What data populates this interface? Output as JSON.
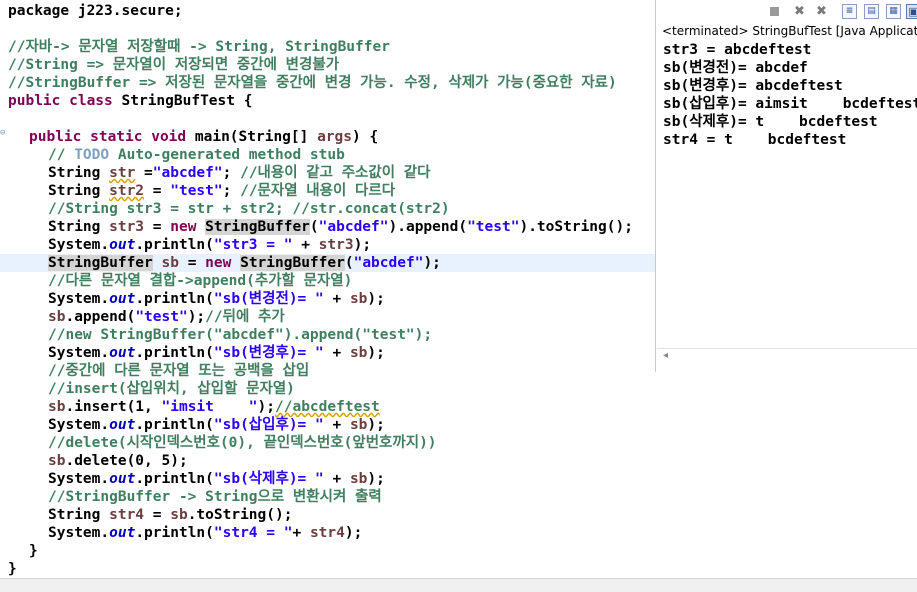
{
  "editor": {
    "current_line_index": 14,
    "lines": [
      {
        "indent": 0,
        "tokens": [
          {
            "t": "package j223.secure;",
            "c": "pl"
          }
        ]
      },
      {
        "indent": 0,
        "tokens": []
      },
      {
        "indent": 0,
        "tokens": [
          {
            "t": "//자바-> 문자열 저장할때 -> String, StringBuffer",
            "c": "cm"
          }
        ]
      },
      {
        "indent": 0,
        "tokens": [
          {
            "t": "//String => 문자열이 저장되면 중간에 변경불가",
            "c": "cm"
          }
        ]
      },
      {
        "indent": 0,
        "tokens": [
          {
            "t": "//StringBuffer => 저장된 문자열을 중간에 변경 가능. 수정, 삭제가 가능(중요한 자료)",
            "c": "cm"
          }
        ]
      },
      {
        "indent": 0,
        "tokens": [
          {
            "t": "public class ",
            "c": "kw"
          },
          {
            "t": "StringBufTest {",
            "c": "pl"
          }
        ]
      },
      {
        "indent": 0,
        "tokens": []
      },
      {
        "indent": 1,
        "tokens": [
          {
            "t": "public static void ",
            "c": "kw"
          },
          {
            "t": "main(String[] ",
            "c": "pl"
          },
          {
            "t": "args",
            "c": "var"
          },
          {
            "t": ") {",
            "c": "pl"
          }
        ]
      },
      {
        "indent": 2,
        "tokens": [
          {
            "t": "// ",
            "c": "cm"
          },
          {
            "t": "TODO",
            "c": "todo"
          },
          {
            "t": " Auto-generated method stub",
            "c": "cm"
          }
        ]
      },
      {
        "indent": 2,
        "tokens": [
          {
            "t": "String ",
            "c": "pl"
          },
          {
            "t": "str",
            "c": "var",
            "w": true
          },
          {
            "t": " =",
            "c": "pl"
          },
          {
            "t": "\"abcdef\"",
            "c": "st"
          },
          {
            "t": "; ",
            "c": "pl"
          },
          {
            "t": "//내용이 같고 주소값이 같다",
            "c": "cm"
          }
        ]
      },
      {
        "indent": 2,
        "tokens": [
          {
            "t": "String ",
            "c": "pl"
          },
          {
            "t": "str2",
            "c": "var",
            "w": true
          },
          {
            "t": " = ",
            "c": "pl"
          },
          {
            "t": "\"test\"",
            "c": "st"
          },
          {
            "t": "; ",
            "c": "pl"
          },
          {
            "t": "//문자열 내용이 다르다",
            "c": "cm"
          }
        ]
      },
      {
        "indent": 2,
        "tokens": [
          {
            "t": "//String str3 = str + str2; //str.concat(str2)",
            "c": "cm"
          }
        ]
      },
      {
        "indent": 2,
        "tokens": [
          {
            "t": "String ",
            "c": "pl"
          },
          {
            "t": "str3",
            "c": "var"
          },
          {
            "t": " = ",
            "c": "pl"
          },
          {
            "t": "new ",
            "c": "kw"
          },
          {
            "t": "StringBuffer",
            "c": "pl",
            "h": true
          },
          {
            "t": "(",
            "c": "pl"
          },
          {
            "t": "\"abcdef\"",
            "c": "st"
          },
          {
            "t": ").append(",
            "c": "pl"
          },
          {
            "t": "\"test\"",
            "c": "st"
          },
          {
            "t": ").toString();",
            "c": "pl"
          }
        ]
      },
      {
        "indent": 2,
        "tokens": [
          {
            "t": "System.",
            "c": "pl"
          },
          {
            "t": "out",
            "c": "fd"
          },
          {
            "t": ".println(",
            "c": "pl"
          },
          {
            "t": "\"str3 = \"",
            "c": "st"
          },
          {
            "t": " + ",
            "c": "pl"
          },
          {
            "t": "str3",
            "c": "var"
          },
          {
            "t": ");",
            "c": "pl"
          }
        ]
      },
      {
        "indent": 2,
        "tokens": [
          {
            "t": "StringBuffer",
            "c": "pl",
            "h": true
          },
          {
            "t": " ",
            "c": "pl"
          },
          {
            "t": "sb",
            "c": "var"
          },
          {
            "t": " = ",
            "c": "pl"
          },
          {
            "t": "new ",
            "c": "kw"
          },
          {
            "t": "StringBuffer",
            "c": "pl",
            "h": true
          },
          {
            "t": "(",
            "c": "pl"
          },
          {
            "t": "\"abcdef\"",
            "c": "st"
          },
          {
            "t": ");",
            "c": "pl"
          }
        ]
      },
      {
        "indent": 2,
        "tokens": [
          {
            "t": "//다른 문자열 결합->append(추가할 문자열)",
            "c": "cm"
          }
        ]
      },
      {
        "indent": 2,
        "tokens": [
          {
            "t": "System.",
            "c": "pl"
          },
          {
            "t": "out",
            "c": "fd"
          },
          {
            "t": ".println(",
            "c": "pl"
          },
          {
            "t": "\"sb(변경전)= \"",
            "c": "st"
          },
          {
            "t": " + ",
            "c": "pl"
          },
          {
            "t": "sb",
            "c": "var"
          },
          {
            "t": ");",
            "c": "pl"
          }
        ]
      },
      {
        "indent": 2,
        "tokens": [
          {
            "t": "sb",
            "c": "var"
          },
          {
            "t": ".append(",
            "c": "pl"
          },
          {
            "t": "\"test\"",
            "c": "st"
          },
          {
            "t": ");",
            "c": "pl"
          },
          {
            "t": "//뒤에 추가",
            "c": "cm"
          }
        ]
      },
      {
        "indent": 2,
        "tokens": [
          {
            "t": "//new StringBuffer(\"abcdef\").append(\"test\");",
            "c": "cm"
          }
        ]
      },
      {
        "indent": 2,
        "tokens": [
          {
            "t": "System.",
            "c": "pl"
          },
          {
            "t": "out",
            "c": "fd"
          },
          {
            "t": ".println(",
            "c": "pl"
          },
          {
            "t": "\"sb(변경후)= \"",
            "c": "st"
          },
          {
            "t": " + ",
            "c": "pl"
          },
          {
            "t": "sb",
            "c": "var"
          },
          {
            "t": ");",
            "c": "pl"
          }
        ]
      },
      {
        "indent": 2,
        "tokens": [
          {
            "t": "//중간에 다른 문자열 또는 공백을 삽입",
            "c": "cm"
          }
        ]
      },
      {
        "indent": 2,
        "tokens": [
          {
            "t": "//insert(삽입위치, 삽입할 문자열)",
            "c": "cm"
          }
        ]
      },
      {
        "indent": 2,
        "tokens": [
          {
            "t": "sb",
            "c": "var"
          },
          {
            "t": ".insert(1, ",
            "c": "pl"
          },
          {
            "t": "\"imsit    \"",
            "c": "st"
          },
          {
            "t": ");",
            "c": "pl"
          },
          {
            "t": "//abcdeftest",
            "c": "cm",
            "w": true
          }
        ]
      },
      {
        "indent": 2,
        "tokens": [
          {
            "t": "System.",
            "c": "pl"
          },
          {
            "t": "out",
            "c": "fd"
          },
          {
            "t": ".println(",
            "c": "pl"
          },
          {
            "t": "\"sb(삽입후)= \"",
            "c": "st"
          },
          {
            "t": " + ",
            "c": "pl"
          },
          {
            "t": "sb",
            "c": "var"
          },
          {
            "t": ");",
            "c": "pl"
          }
        ]
      },
      {
        "indent": 2,
        "tokens": [
          {
            "t": "//delete(시작인덱스번호(0), 끝인덱스번호(앞번호까지))",
            "c": "cm"
          }
        ]
      },
      {
        "indent": 2,
        "tokens": [
          {
            "t": "sb",
            "c": "var"
          },
          {
            "t": ".delete(0, 5);",
            "c": "pl"
          }
        ]
      },
      {
        "indent": 2,
        "tokens": [
          {
            "t": "System.",
            "c": "pl"
          },
          {
            "t": "out",
            "c": "fd"
          },
          {
            "t": ".println(",
            "c": "pl"
          },
          {
            "t": "\"sb(삭제후)= \"",
            "c": "st"
          },
          {
            "t": " + ",
            "c": "pl"
          },
          {
            "t": "sb",
            "c": "var"
          },
          {
            "t": ");",
            "c": "pl"
          }
        ]
      },
      {
        "indent": 2,
        "tokens": [
          {
            "t": "//StringBuffer -> String으로 변환시켜 출력",
            "c": "cm"
          }
        ]
      },
      {
        "indent": 2,
        "tokens": [
          {
            "t": "String ",
            "c": "pl"
          },
          {
            "t": "str4",
            "c": "var"
          },
          {
            "t": " = ",
            "c": "pl"
          },
          {
            "t": "sb",
            "c": "var"
          },
          {
            "t": ".toString();",
            "c": "pl"
          }
        ]
      },
      {
        "indent": 2,
        "tokens": [
          {
            "t": "System.",
            "c": "pl"
          },
          {
            "t": "out",
            "c": "fd"
          },
          {
            "t": ".println(",
            "c": "pl"
          },
          {
            "t": "\"str4 = \"",
            "c": "st"
          },
          {
            "t": "+ ",
            "c": "pl"
          },
          {
            "t": "str4",
            "c": "var"
          },
          {
            "t": ");",
            "c": "pl"
          }
        ]
      },
      {
        "indent": 1,
        "tokens": [
          {
            "t": "}",
            "c": "pl"
          }
        ]
      },
      {
        "indent": 0,
        "tokens": [
          {
            "t": "}",
            "c": "pl"
          }
        ]
      }
    ]
  },
  "console": {
    "status": "<terminated> StringBufTest [Java Application] C",
    "toolbar": [
      {
        "name": "terminate-icon",
        "glyph": ""
      },
      {
        "name": "remove-launch-icon",
        "glyph": "✖"
      },
      {
        "name": "remove-all-launches-icon",
        "glyph": "✖"
      },
      {
        "name": "clear-console-icon",
        "glyph": "≡"
      },
      {
        "name": "scroll-lock-icon",
        "glyph": "▤"
      },
      {
        "name": "word-wrap-icon",
        "glyph": "▦"
      },
      {
        "name": "pin-console-icon",
        "glyph": "▣"
      },
      {
        "name": "display-console-icon",
        "glyph": "▭"
      }
    ],
    "output": [
      "str3 = abcdeftest",
      "sb(변경전)= abcdef",
      "sb(변경후)= abcdeftest",
      "sb(삽입후)= aimsit    bcdeftest",
      "sb(삭제후)= t    bcdeftest",
      "str4 = t    bcdeftest"
    ],
    "scroll_arrow": "◂"
  }
}
